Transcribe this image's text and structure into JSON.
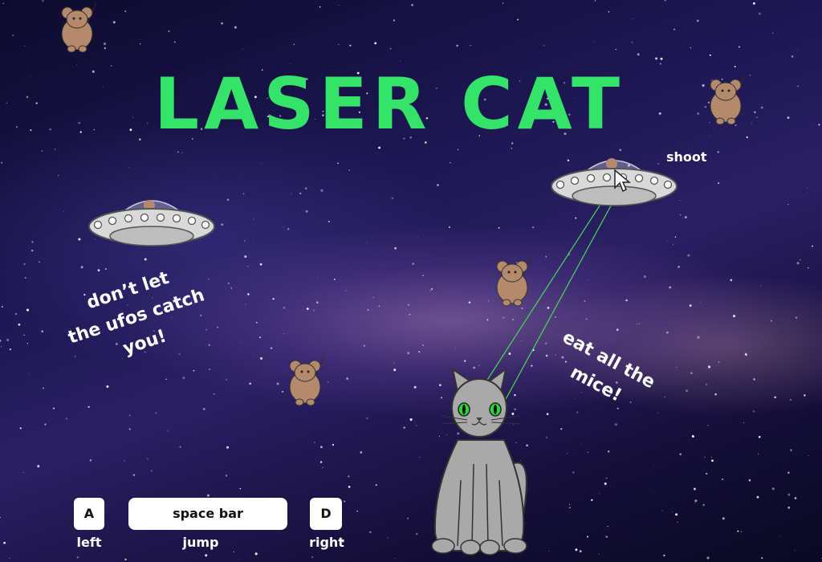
{
  "game": {
    "title": "LASER CAT",
    "hint_ufos": [
      "don’t let",
      "the ufos catch",
      "you!"
    ],
    "hint_mice": [
      "eat all the",
      "mice!"
    ],
    "shoot_label": "shoot"
  },
  "controls": {
    "left": {
      "key": "A",
      "action": "left"
    },
    "jump": {
      "key": "space bar",
      "action": "jump"
    },
    "right": {
      "key": "D",
      "action": "right"
    }
  },
  "colors": {
    "title": "#35e26a",
    "laser": "#44dd55",
    "cat": "#a9a9a9",
    "mouse": "#b58a6c"
  },
  "icons": [
    "mouse-icon",
    "ufo-icon",
    "cat-icon",
    "cursor-icon"
  ]
}
